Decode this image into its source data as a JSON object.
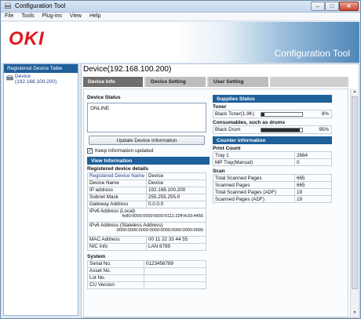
{
  "window": {
    "title": "Configuration Tool"
  },
  "menu": [
    "File",
    "Tools",
    "Plug-ins",
    "View",
    "Help"
  ],
  "banner": {
    "logo": "OKI",
    "title": "Configuration Tool"
  },
  "sidebar": {
    "header": "Registered Device Table",
    "items": [
      {
        "name": "Device",
        "address": "(192.168.100.200)"
      }
    ]
  },
  "device_title": "Device(192.168.100.200)",
  "tabs": [
    {
      "label": "Device Info",
      "active": true
    },
    {
      "label": "Device Setting",
      "active": false
    },
    {
      "label": "User Setting",
      "active": false
    }
  ],
  "device_status": {
    "label": "Device Status",
    "value": "ONLINE",
    "update_button": "Update Device Information",
    "keep_label": "Keep information updated",
    "keep_checked": true
  },
  "view_info": {
    "header": "View Information",
    "reg_label": "Registered device details",
    "rows": [
      {
        "k": "Registered Device Name",
        "v": "Device"
      },
      {
        "k": "Device Name",
        "v": "Device"
      },
      {
        "k": "IP address",
        "v": "192.168.100.200"
      },
      {
        "k": "Subnet Mask",
        "v": "255.255.255.0"
      },
      {
        "k": "Gateway Address",
        "v": "0.0.0.0"
      }
    ],
    "ipv6_local_label": "IPv6 Address (Local)",
    "ipv6_local_value": "fe80:0000:0000:0000:0111:22ff:fe33:4455",
    "ipv6_stateless_label": "IPv6 Address (Stateless Address)",
    "ipv6_stateless_value": "0000:0000:0000:0000:0000:0000:0000:0000",
    "rows2": [
      {
        "k": "MAC Address",
        "v": "00 11 22 33 44 55"
      },
      {
        "k": "NIC Info",
        "v": "LAN 6789"
      }
    ]
  },
  "system": {
    "label": "System",
    "rows": [
      {
        "k": "Serial No.",
        "v": "0123456789"
      },
      {
        "k": "Asset No.",
        "v": ""
      },
      {
        "k": "Lot No.",
        "v": ""
      },
      {
        "k": "CU Version",
        "v": ""
      }
    ]
  },
  "supplies": {
    "header": "Supplies Status",
    "toner_label": "Toner",
    "toner": [
      {
        "name": "Black Toner(1.9K)",
        "percent": 8,
        "pct_text": "8%"
      }
    ],
    "drum_label": "Consumables, such as drums",
    "drums": [
      {
        "name": "Black Drum",
        "percent": 95,
        "pct_text": "95%"
      }
    ]
  },
  "counter": {
    "header": "Counter information",
    "print_label": "Print Count",
    "print_rows": [
      {
        "k": "Tray 1",
        "v": "2684"
      },
      {
        "k": "MP Tray(Manual)",
        "v": "0"
      }
    ],
    "scan_label": "Scan",
    "scan_rows": [
      {
        "k": "Total Scanned Pages",
        "v": "665"
      },
      {
        "k": "Scanned Pages",
        "v": "665"
      },
      {
        "k": "Total Scanned Pages (ADF)",
        "v": "19"
      },
      {
        "k": "Scanned Pages (ADF)",
        "v": "19"
      }
    ]
  },
  "colors": {
    "accent": "#1f5f9a",
    "logo": "#e0181e",
    "tab_active": "#6e6e6e"
  }
}
